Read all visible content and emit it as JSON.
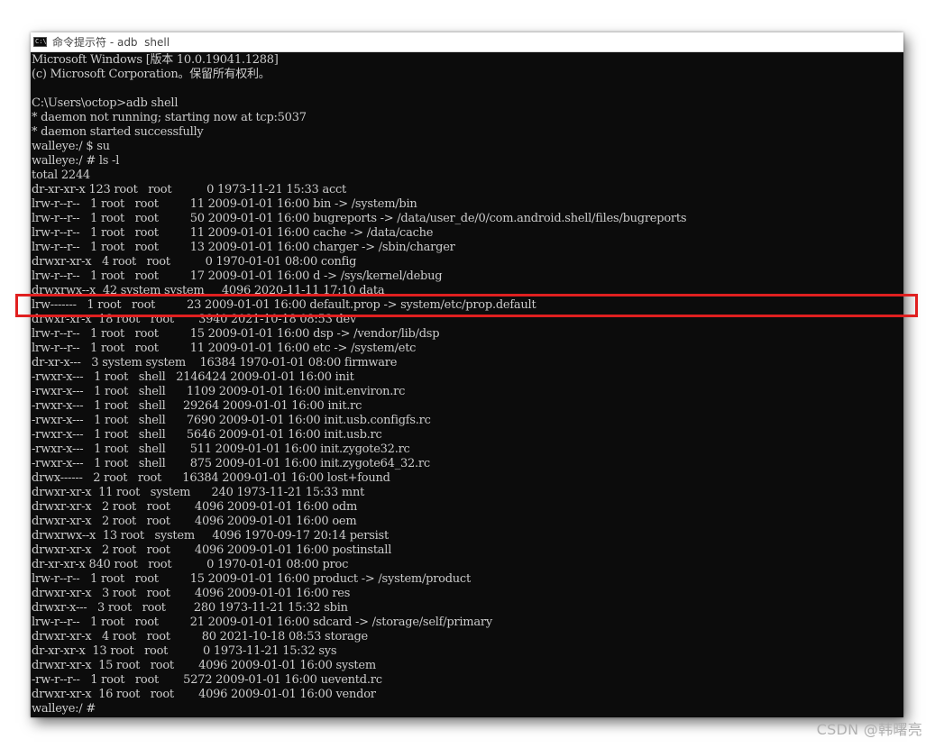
{
  "window": {
    "icon_text": "C:\\",
    "title": "命令提示符 - adb  shell"
  },
  "console_lines": [
    "Microsoft Windows [版本 10.0.19041.1288]",
    "(c) Microsoft Corporation。保留所有权利。",
    "",
    "C:\\Users\\octop>adb shell",
    "* daemon not running; starting now at tcp:5037",
    "* daemon started successfully",
    "walleye:/ $ su",
    "walleye:/ # ls -l",
    "total 2244",
    "dr-xr-xr-x 123 root   root          0 1973-11-21 15:33 acct",
    "lrw-r--r--   1 root   root         11 2009-01-01 16:00 bin -> /system/bin",
    "lrw-r--r--   1 root   root         50 2009-01-01 16:00 bugreports -> /data/user_de/0/com.android.shell/files/bugreports",
    "lrw-r--r--   1 root   root         11 2009-01-01 16:00 cache -> /data/cache",
    "lrw-r--r--   1 root   root         13 2009-01-01 16:00 charger -> /sbin/charger",
    "drwxr-xr-x   4 root   root          0 1970-01-01 08:00 config",
    "lrw-r--r--   1 root   root         17 2009-01-01 16:00 d -> /sys/kernel/debug",
    "drwxrwx--x  42 system system     4096 2020-11-11 17:10 data",
    "lrw-------   1 root   root         23 2009-01-01 16:00 default.prop -> system/etc/prop.default",
    "drwxr-xr-x  18 root   root       3940 2021-10-18 08:53 dev",
    "lrw-r--r--   1 root   root         15 2009-01-01 16:00 dsp -> /vendor/lib/dsp",
    "lrw-r--r--   1 root   root         11 2009-01-01 16:00 etc -> /system/etc",
    "dr-xr-x---   3 system system    16384 1970-01-01 08:00 firmware",
    "-rwxr-x---   1 root   shell   2146424 2009-01-01 16:00 init",
    "-rwxr-x---   1 root   shell      1109 2009-01-01 16:00 init.environ.rc",
    "-rwxr-x---   1 root   shell     29264 2009-01-01 16:00 init.rc",
    "-rwxr-x---   1 root   shell      7690 2009-01-01 16:00 init.usb.configfs.rc",
    "-rwxr-x---   1 root   shell      5646 2009-01-01 16:00 init.usb.rc",
    "-rwxr-x---   1 root   shell       511 2009-01-01 16:00 init.zygote32.rc",
    "-rwxr-x---   1 root   shell       875 2009-01-01 16:00 init.zygote64_32.rc",
    "drwx------   2 root   root      16384 2009-01-01 16:00 lost+found",
    "drwxr-xr-x  11 root   system      240 1973-11-21 15:33 mnt",
    "drwxr-xr-x   2 root   root       4096 2009-01-01 16:00 odm",
    "drwxr-xr-x   2 root   root       4096 2009-01-01 16:00 oem",
    "drwxrwx--x  13 root   system     4096 1970-09-17 20:14 persist",
    "drwxr-xr-x   2 root   root       4096 2009-01-01 16:00 postinstall",
    "dr-xr-xr-x 840 root   root          0 1970-01-01 08:00 proc",
    "lrw-r--r--   1 root   root         15 2009-01-01 16:00 product -> /system/product",
    "drwxr-xr-x   3 root   root       4096 2009-01-01 16:00 res",
    "drwxr-x---   3 root   root        280 1973-11-21 15:32 sbin",
    "lrw-r--r--   1 root   root         21 2009-01-01 16:00 sdcard -> /storage/self/primary",
    "drwxr-xr-x   4 root   root         80 2021-10-18 08:53 storage",
    "dr-xr-xr-x  13 root   root          0 1973-11-21 15:32 sys",
    "drwxr-xr-x  15 root   root       4096 2009-01-01 16:00 system",
    "-rw-r--r--   1 root   root       5272 2009-01-01 16:00 ueventd.rc",
    "drwxr-xr-x  16 root   root       4096 2009-01-01 16:00 vendor",
    "walleye:/ #"
  ],
  "watermark": "CSDN @韩曙亮"
}
